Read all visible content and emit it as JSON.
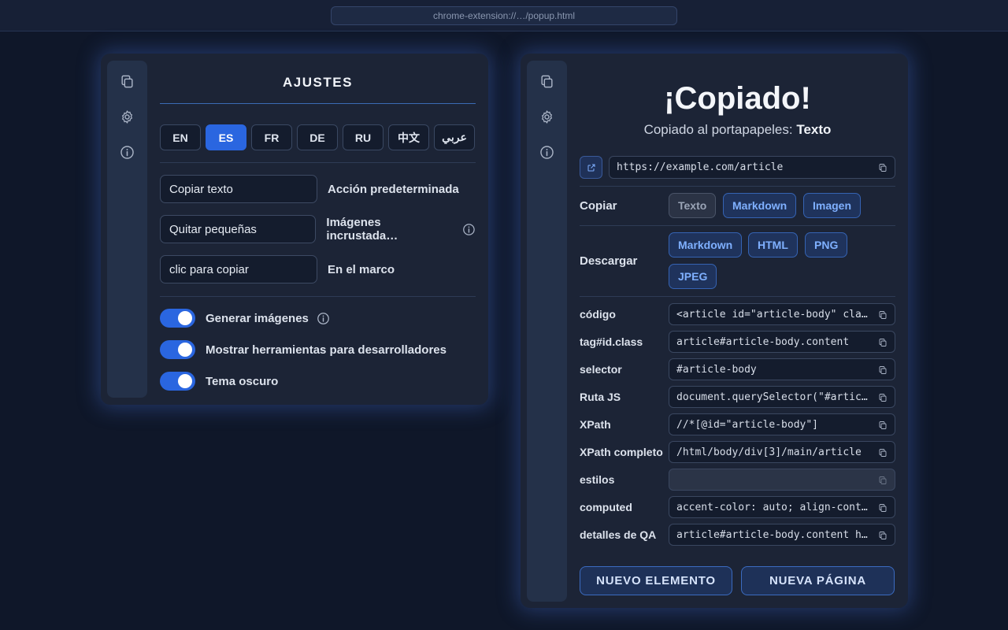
{
  "browser": {
    "url": "chrome-extension://…/popup.html"
  },
  "rail": {
    "icons": [
      "copy-icon",
      "gear-icon",
      "info-icon"
    ]
  },
  "settings": {
    "title": "AJUSTES",
    "languages": [
      {
        "code": "EN",
        "active": false
      },
      {
        "code": "ES",
        "active": true
      },
      {
        "code": "FR",
        "active": false
      },
      {
        "code": "DE",
        "active": false
      },
      {
        "code": "RU",
        "active": false
      },
      {
        "code": "中文",
        "active": false
      },
      {
        "code": "عربي",
        "active": false
      }
    ],
    "selects": [
      {
        "value": "Copiar texto",
        "label": "Acción predeterminada"
      },
      {
        "value": "Quitar pequeñas",
        "label": "Imágenes incrustada…",
        "info": true
      },
      {
        "value": "clic para copiar",
        "label": "En el marco"
      }
    ],
    "toggles": [
      {
        "label": "Generar imágenes",
        "on": true,
        "info": true
      },
      {
        "label": "Mostrar herramientas para desarrolladores",
        "on": true
      },
      {
        "label": "Tema oscuro",
        "on": true
      }
    ]
  },
  "copied": {
    "title": "¡Copiado!",
    "subtitle_prefix": "Copiado al portapapeles: ",
    "subtitle_value": "Texto",
    "url": "https://example.com/article",
    "copy_label": "Copiar",
    "copy_buttons": [
      "Texto",
      "Markdown",
      "Imagen"
    ],
    "download_label": "Descargar",
    "download_buttons": [
      "Markdown",
      "HTML",
      "PNG",
      "JPEG"
    ],
    "fields": [
      {
        "label": "código",
        "value": "<article id=\"article-body\" class=\"content\">"
      },
      {
        "label": "tag#id.class",
        "value": "article#article-body.content"
      },
      {
        "label": "selector",
        "value": "#article-body"
      },
      {
        "label": "Ruta JS",
        "value": "document.querySelector(\"#article-body\")"
      },
      {
        "label": "XPath",
        "value": "//*[@id=\"article-body\"]"
      },
      {
        "label": "XPath completo",
        "value": "/html/body/div[3]/main/article"
      },
      {
        "label": "estilos",
        "value": ""
      },
      {
        "label": "computed",
        "value": "accent-color: auto; align-content: normal;"
      },
      {
        "label": "detalles de QA",
        "value": "article#article-body.content html body"
      }
    ],
    "new_element": "NUEVO ELEMENTO",
    "new_page": "NUEVA PÁGINA"
  },
  "colors": {
    "accent": "#2a66e0",
    "panel": "#1c2436",
    "background": "#0f1729",
    "link": "#7fb0ff"
  }
}
